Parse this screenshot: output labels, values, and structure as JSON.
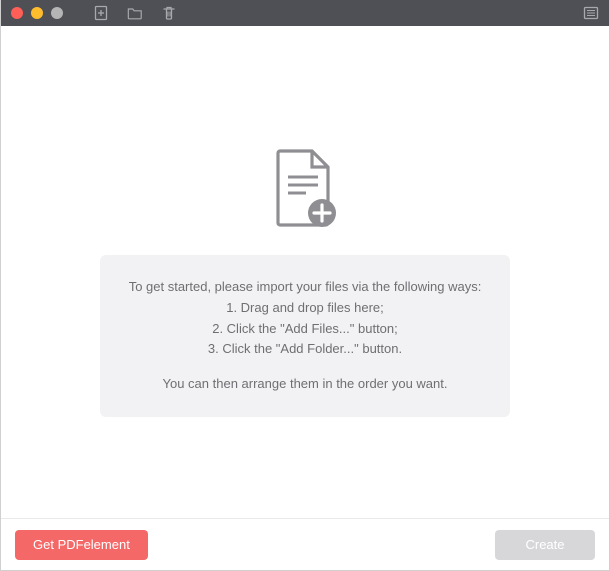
{
  "titlebar": {
    "icons": {
      "add_file": "add-file-icon",
      "add_folder": "folder-icon",
      "delete": "trash-icon",
      "sidebar": "sidebar-icon"
    }
  },
  "main": {
    "drop_icon": "document-add-icon",
    "instructions": {
      "lead": "To get started, please import your files via the following ways:",
      "step1": "1. Drag and drop files here;",
      "step2": "2. Click the \"Add Files...\" button;",
      "step3": "3. Click the \"Add Folder...\" button.",
      "trail": "You can then arrange them in the order you want."
    }
  },
  "footer": {
    "get_pdfelement_label": "Get PDFelement",
    "create_label": "Create"
  }
}
